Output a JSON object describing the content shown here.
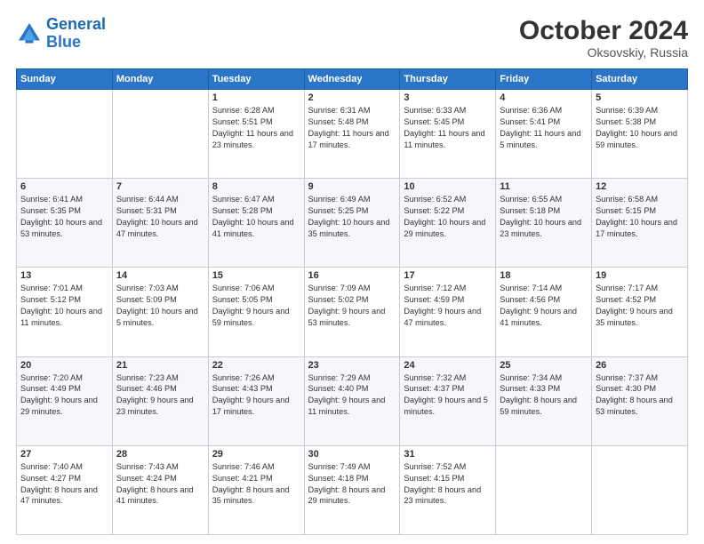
{
  "logo": {
    "line1": "General",
    "line2": "Blue"
  },
  "title": {
    "month_year": "October 2024",
    "location": "Oksovskiy, Russia"
  },
  "weekdays": [
    "Sunday",
    "Monday",
    "Tuesday",
    "Wednesday",
    "Thursday",
    "Friday",
    "Saturday"
  ],
  "weeks": [
    [
      {
        "day": "",
        "text": ""
      },
      {
        "day": "",
        "text": ""
      },
      {
        "day": "1",
        "text": "Sunrise: 6:28 AM\nSunset: 5:51 PM\nDaylight: 11 hours and 23 minutes."
      },
      {
        "day": "2",
        "text": "Sunrise: 6:31 AM\nSunset: 5:48 PM\nDaylight: 11 hours and 17 minutes."
      },
      {
        "day": "3",
        "text": "Sunrise: 6:33 AM\nSunset: 5:45 PM\nDaylight: 11 hours and 11 minutes."
      },
      {
        "day": "4",
        "text": "Sunrise: 6:36 AM\nSunset: 5:41 PM\nDaylight: 11 hours and 5 minutes."
      },
      {
        "day": "5",
        "text": "Sunrise: 6:39 AM\nSunset: 5:38 PM\nDaylight: 10 hours and 59 minutes."
      }
    ],
    [
      {
        "day": "6",
        "text": "Sunrise: 6:41 AM\nSunset: 5:35 PM\nDaylight: 10 hours and 53 minutes."
      },
      {
        "day": "7",
        "text": "Sunrise: 6:44 AM\nSunset: 5:31 PM\nDaylight: 10 hours and 47 minutes."
      },
      {
        "day": "8",
        "text": "Sunrise: 6:47 AM\nSunset: 5:28 PM\nDaylight: 10 hours and 41 minutes."
      },
      {
        "day": "9",
        "text": "Sunrise: 6:49 AM\nSunset: 5:25 PM\nDaylight: 10 hours and 35 minutes."
      },
      {
        "day": "10",
        "text": "Sunrise: 6:52 AM\nSunset: 5:22 PM\nDaylight: 10 hours and 29 minutes."
      },
      {
        "day": "11",
        "text": "Sunrise: 6:55 AM\nSunset: 5:18 PM\nDaylight: 10 hours and 23 minutes."
      },
      {
        "day": "12",
        "text": "Sunrise: 6:58 AM\nSunset: 5:15 PM\nDaylight: 10 hours and 17 minutes."
      }
    ],
    [
      {
        "day": "13",
        "text": "Sunrise: 7:01 AM\nSunset: 5:12 PM\nDaylight: 10 hours and 11 minutes."
      },
      {
        "day": "14",
        "text": "Sunrise: 7:03 AM\nSunset: 5:09 PM\nDaylight: 10 hours and 5 minutes."
      },
      {
        "day": "15",
        "text": "Sunrise: 7:06 AM\nSunset: 5:05 PM\nDaylight: 9 hours and 59 minutes."
      },
      {
        "day": "16",
        "text": "Sunrise: 7:09 AM\nSunset: 5:02 PM\nDaylight: 9 hours and 53 minutes."
      },
      {
        "day": "17",
        "text": "Sunrise: 7:12 AM\nSunset: 4:59 PM\nDaylight: 9 hours and 47 minutes."
      },
      {
        "day": "18",
        "text": "Sunrise: 7:14 AM\nSunset: 4:56 PM\nDaylight: 9 hours and 41 minutes."
      },
      {
        "day": "19",
        "text": "Sunrise: 7:17 AM\nSunset: 4:52 PM\nDaylight: 9 hours and 35 minutes."
      }
    ],
    [
      {
        "day": "20",
        "text": "Sunrise: 7:20 AM\nSunset: 4:49 PM\nDaylight: 9 hours and 29 minutes."
      },
      {
        "day": "21",
        "text": "Sunrise: 7:23 AM\nSunset: 4:46 PM\nDaylight: 9 hours and 23 minutes."
      },
      {
        "day": "22",
        "text": "Sunrise: 7:26 AM\nSunset: 4:43 PM\nDaylight: 9 hours and 17 minutes."
      },
      {
        "day": "23",
        "text": "Sunrise: 7:29 AM\nSunset: 4:40 PM\nDaylight: 9 hours and 11 minutes."
      },
      {
        "day": "24",
        "text": "Sunrise: 7:32 AM\nSunset: 4:37 PM\nDaylight: 9 hours and 5 minutes."
      },
      {
        "day": "25",
        "text": "Sunrise: 7:34 AM\nSunset: 4:33 PM\nDaylight: 8 hours and 59 minutes."
      },
      {
        "day": "26",
        "text": "Sunrise: 7:37 AM\nSunset: 4:30 PM\nDaylight: 8 hours and 53 minutes."
      }
    ],
    [
      {
        "day": "27",
        "text": "Sunrise: 7:40 AM\nSunset: 4:27 PM\nDaylight: 8 hours and 47 minutes."
      },
      {
        "day": "28",
        "text": "Sunrise: 7:43 AM\nSunset: 4:24 PM\nDaylight: 8 hours and 41 minutes."
      },
      {
        "day": "29",
        "text": "Sunrise: 7:46 AM\nSunset: 4:21 PM\nDaylight: 8 hours and 35 minutes."
      },
      {
        "day": "30",
        "text": "Sunrise: 7:49 AM\nSunset: 4:18 PM\nDaylight: 8 hours and 29 minutes."
      },
      {
        "day": "31",
        "text": "Sunrise: 7:52 AM\nSunset: 4:15 PM\nDaylight: 8 hours and 23 minutes."
      },
      {
        "day": "",
        "text": ""
      },
      {
        "day": "",
        "text": ""
      }
    ]
  ]
}
